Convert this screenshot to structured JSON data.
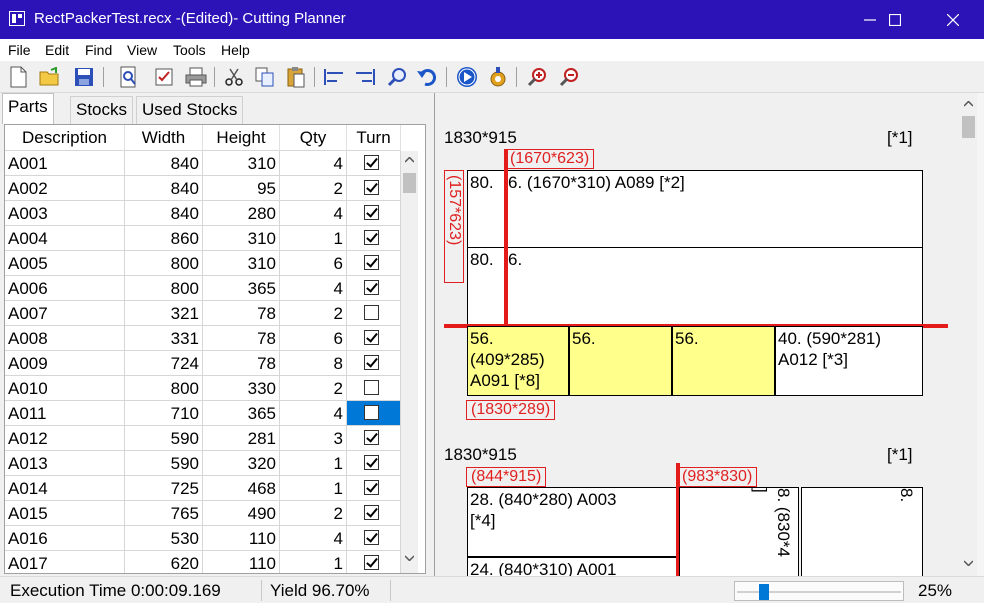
{
  "window": {
    "title": "RectPackerTest.recx -(Edited)- Cutting Planner"
  },
  "menu": [
    "File",
    "Edit",
    "Find",
    "View",
    "Tools",
    "Help"
  ],
  "toolbar": {
    "icons": [
      "new-file-icon",
      "open-folder-icon",
      "save-icon",
      "preview-icon",
      "check-list-icon",
      "print-icon",
      "cut-icon",
      "copy-icon",
      "paste-icon",
      "align-left-icon",
      "align-right-icon",
      "search-icon",
      "undo-icon",
      "run-icon",
      "settings-icon",
      "zoom-in-icon",
      "zoom-out-icon"
    ]
  },
  "tabs": [
    {
      "label": "Parts",
      "active": true
    },
    {
      "label": "Stocks",
      "active": false
    },
    {
      "label": "Used Stocks",
      "active": false
    }
  ],
  "table": {
    "columns": [
      "Description",
      "Width",
      "Height",
      "Qty",
      "Turn"
    ],
    "rows": [
      {
        "desc": "A001",
        "width": "840",
        "height": "310",
        "qty": "4",
        "turn": true
      },
      {
        "desc": "A002",
        "width": "840",
        "height": "95",
        "qty": "2",
        "turn": true
      },
      {
        "desc": "A003",
        "width": "840",
        "height": "280",
        "qty": "4",
        "turn": true
      },
      {
        "desc": "A004",
        "width": "860",
        "height": "310",
        "qty": "1",
        "turn": true
      },
      {
        "desc": "A005",
        "width": "800",
        "height": "310",
        "qty": "6",
        "turn": true
      },
      {
        "desc": "A006",
        "width": "800",
        "height": "365",
        "qty": "4",
        "turn": true
      },
      {
        "desc": "A007",
        "width": "321",
        "height": "78",
        "qty": "2",
        "turn": false
      },
      {
        "desc": "A008",
        "width": "331",
        "height": "78",
        "qty": "6",
        "turn": true
      },
      {
        "desc": "A009",
        "width": "724",
        "height": "78",
        "qty": "8",
        "turn": true
      },
      {
        "desc": "A010",
        "width": "800",
        "height": "330",
        "qty": "2",
        "turn": false
      },
      {
        "desc": "A011",
        "width": "710",
        "height": "365",
        "qty": "4",
        "turn": false,
        "selected": true
      },
      {
        "desc": "A012",
        "width": "590",
        "height": "281",
        "qty": "3",
        "turn": true
      },
      {
        "desc": "A013",
        "width": "590",
        "height": "320",
        "qty": "1",
        "turn": true
      },
      {
        "desc": "A014",
        "width": "725",
        "height": "468",
        "qty": "1",
        "turn": true
      },
      {
        "desc": "A015",
        "width": "765",
        "height": "490",
        "qty": "2",
        "turn": true
      },
      {
        "desc": "A016",
        "width": "530",
        "height": "110",
        "qty": "4",
        "turn": true
      },
      {
        "desc": "A017",
        "width": "620",
        "height": "110",
        "qty": "1",
        "turn": true
      }
    ]
  },
  "plan": {
    "sheet1": {
      "size": "1830*915",
      "count": "[*1]",
      "cut_label_top": "(1670*623)",
      "cut_label_left": "(157*623)",
      "cut_label_bottom": "(1830*289)",
      "piece_a_left": "80.",
      "piece_a_main": "6. (1670*310) A089 [*2]",
      "piece_b_left": "80.",
      "piece_b_main": "6.",
      "yellow1": "56.\n(409*285)\nA091 [*8]",
      "yellow2": "56.",
      "yellow3": "56.",
      "white_piece": "40. (590*281)\nA012 [*3]"
    },
    "sheet2": {
      "size": "1830*915",
      "count": "[*1]",
      "cut_label_left": "(844*915)",
      "cut_label_right": "(983*830)",
      "piece_a": "28. (840*280) A003\n[*4]",
      "piece_b": "24. (840*310) A001",
      "vertical_piece": "8. (830*4",
      "vertical_bracket": "]",
      "right_piece": "8."
    }
  },
  "status": {
    "execution_time": "Execution Time 0:00:09.169",
    "yield": "Yield 96.70%",
    "zoom": "25%"
  }
}
